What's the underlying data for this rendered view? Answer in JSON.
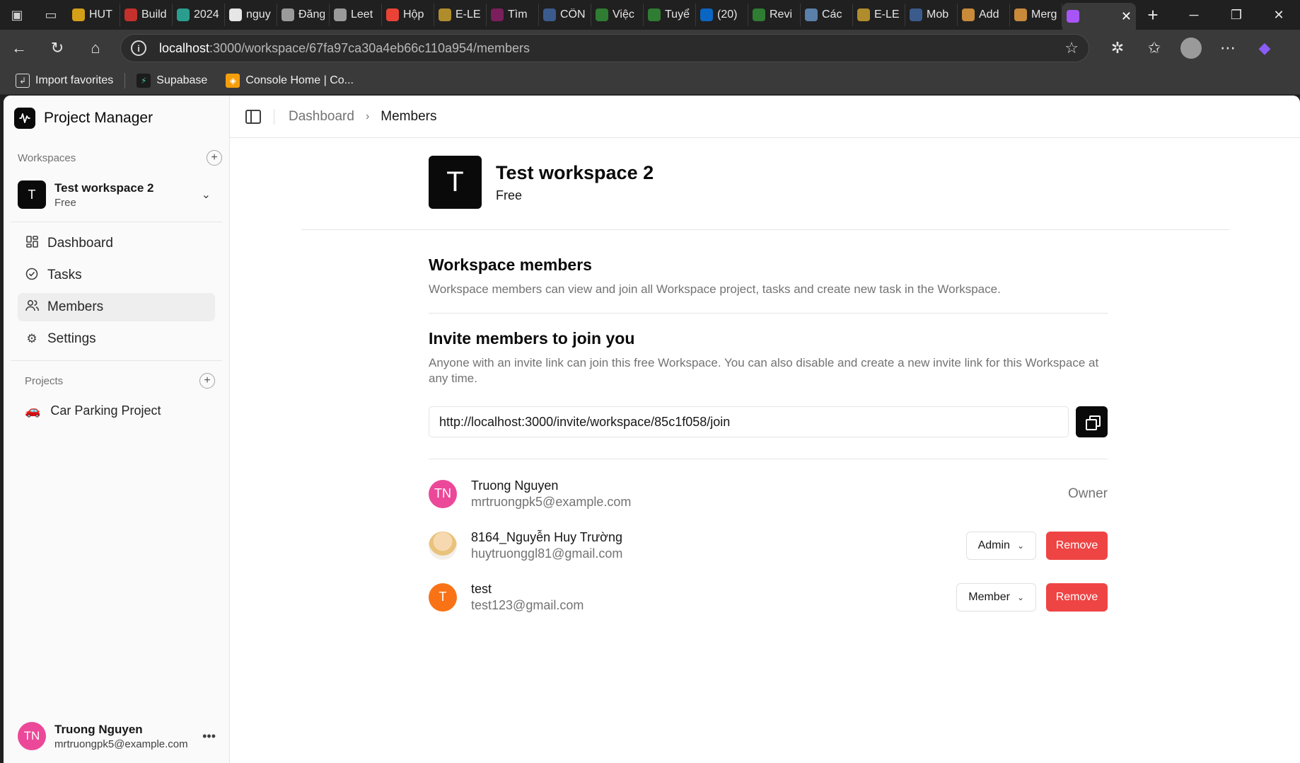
{
  "browser": {
    "tabs": [
      {
        "label": "HUT",
        "color": "#d4a017"
      },
      {
        "label": "Build",
        "color": "#c4302b"
      },
      {
        "label": "2024",
        "color": "#2a9d8f"
      },
      {
        "label": "nguy",
        "color": "#e6e6e6"
      },
      {
        "label": "Đăng",
        "color": "#9a9a9a"
      },
      {
        "label": "Leet",
        "color": "#9a9a9a"
      },
      {
        "label": "Hộp",
        "color": "#ea4335"
      },
      {
        "label": "E-LE",
        "color": "#b08d2c"
      },
      {
        "label": "Tìm",
        "color": "#7a1f5c"
      },
      {
        "label": "CÔN",
        "color": "#3b5b8c"
      },
      {
        "label": "Việc",
        "color": "#2f7d32"
      },
      {
        "label": "Tuyể",
        "color": "#2f7d32"
      },
      {
        "label": "(20)",
        "color": "#0a66c2"
      },
      {
        "label": "Revi",
        "color": "#2e7d32"
      },
      {
        "label": "Các",
        "color": "#5a7fa8"
      },
      {
        "label": "E-LE",
        "color": "#b08d2c"
      },
      {
        "label": "Mob",
        "color": "#3b5b8c"
      },
      {
        "label": "Add",
        "color": "#c98a3a"
      },
      {
        "label": "Merg",
        "color": "#c98a3a"
      }
    ],
    "active_tab_color": "#a855f7",
    "url_host": "localhost",
    "url_rest": ":3000/workspace/67fa97ca30a4eb66c110a954/members",
    "bookmarks": [
      {
        "label": "Import favorites",
        "icon": "import-icon"
      },
      {
        "label": "Supabase",
        "icon": "supabase-icon"
      },
      {
        "label": "Console Home | Co...",
        "icon": "aws-icon"
      }
    ]
  },
  "sidebar": {
    "brand": "Project Manager",
    "workspaces_title": "Workspaces",
    "workspace": {
      "initial": "T",
      "name": "Test workspace 2",
      "plan": "Free"
    },
    "nav": [
      {
        "label": "Dashboard",
        "icon": "grid-icon"
      },
      {
        "label": "Tasks",
        "icon": "check-circle-icon"
      },
      {
        "label": "Members",
        "icon": "users-icon"
      },
      {
        "label": "Settings",
        "icon": "gear-icon"
      }
    ],
    "projects_title": "Projects",
    "projects": [
      {
        "label": "Car Parking Project",
        "emoji": "🚗"
      }
    ],
    "user": {
      "initials": "TN",
      "name": "Truong Nguyen",
      "email": "mrtruongpk5@example.com"
    }
  },
  "header": {
    "breadcrumb_root": "Dashboard",
    "breadcrumb_current": "Members"
  },
  "workspace_header": {
    "initial": "T",
    "name": "Test workspace 2",
    "plan": "Free"
  },
  "members_section": {
    "title": "Workspace members",
    "description": "Workspace members can view and join all Workspace project, tasks and create new task in the Workspace."
  },
  "invite_section": {
    "title": "Invite members to join you",
    "description": "Anyone with an invite link can join this free Workspace. You can also disable and create a new invite link for this Workspace at any time.",
    "link": "http://localhost:3000/invite/workspace/85c1f058/join"
  },
  "members": [
    {
      "initials": "TN",
      "name": "Truong Nguyen",
      "email": "mrtruongpk5@example.com",
      "role": "Owner",
      "avatar_color": "#ec4899"
    },
    {
      "initials": "",
      "name": "8164_Nguyễn Huy Trường",
      "email": "huytruonggl81@gmail.com",
      "role": "Admin",
      "remove_label": "Remove"
    },
    {
      "initials": "T",
      "name": "test",
      "email": "test123@gmail.com",
      "role": "Member",
      "remove_label": "Remove",
      "avatar_color": "#f97316"
    }
  ],
  "colors": {
    "danger": "#ef4444",
    "primary": "#0a0a0a"
  }
}
